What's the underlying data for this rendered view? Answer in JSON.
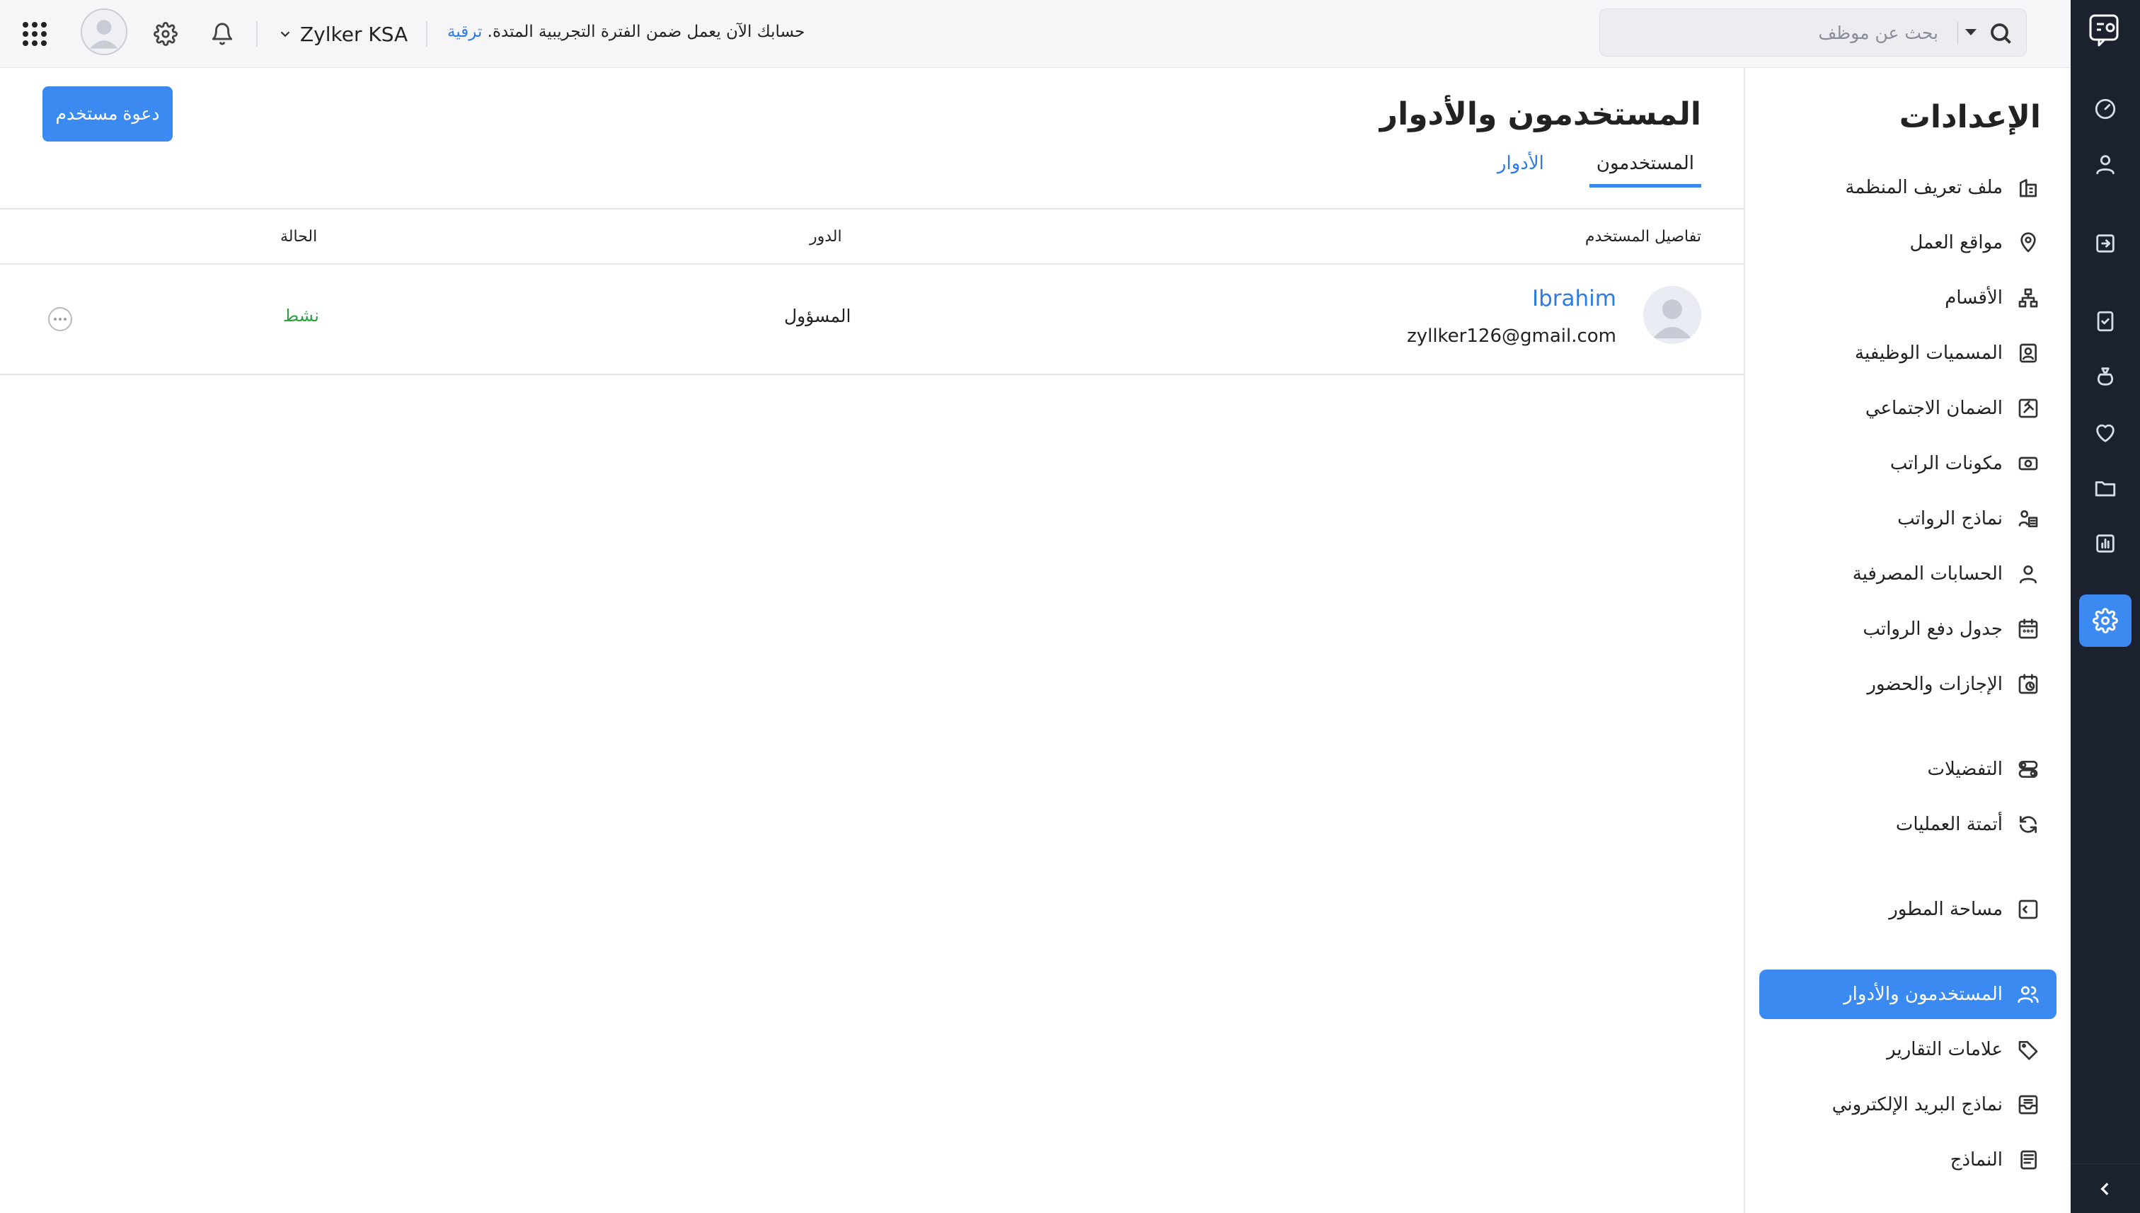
{
  "topbar": {
    "org_name": "Zylker KSA",
    "trial_text": "حسابك الآن يعمل ضمن الفترة التجريبية المتدة.",
    "upgrade_link": "ترقية",
    "search_placeholder": "بحث عن موظف"
  },
  "settings": {
    "title": "الإعدادات",
    "items": [
      {
        "label": "ملف تعريف المنظمة",
        "icon": "building-icon"
      },
      {
        "label": "مواقع العمل",
        "icon": "location-pin-icon"
      },
      {
        "label": "الأقسام",
        "icon": "org-chart-icon"
      },
      {
        "label": "المسميات الوظيفية",
        "icon": "id-badge-icon"
      },
      {
        "label": "الضمان الاجتماعي",
        "icon": "gavel-icon"
      },
      {
        "label": "مكونات الراتب",
        "icon": "money-icon"
      },
      {
        "label": "نماذج الرواتب",
        "icon": "user-template-icon"
      },
      {
        "label": "الحسابات المصرفية",
        "icon": "bank-user-icon"
      },
      {
        "label": "جدول دفع الرواتب",
        "icon": "calendar-icon"
      },
      {
        "label": "الإجازات والحضور",
        "icon": "calendar-clock-icon"
      },
      {
        "label": "التفضيلات",
        "icon": "preferences-icon"
      },
      {
        "label": "أتمتة العمليات",
        "icon": "refresh-icon"
      },
      {
        "label": "مساحة المطور",
        "icon": "code-icon"
      },
      {
        "label": "المستخدمون والأدوار",
        "icon": "users-icon"
      },
      {
        "label": "علامات التقارير",
        "icon": "tag-icon"
      },
      {
        "label": "نماذج البريد الإلكتروني",
        "icon": "mail-template-icon"
      },
      {
        "label": "النماذج",
        "icon": "document-icon"
      }
    ]
  },
  "main": {
    "title": "المستخدمون والأدوار",
    "invite_button": "دعوة مستخدم",
    "tabs": [
      {
        "label": "المستخدمون"
      },
      {
        "label": "الأدوار"
      }
    ],
    "columns": {
      "user_details": "تفاصيل المستخدم",
      "role": "الدور",
      "status": "الحالة"
    },
    "users": [
      {
        "name": "Ibrahim",
        "email": "zyllker126@gmail.com",
        "role": "المسؤول",
        "status": "نشط"
      }
    ]
  },
  "colors": {
    "accent": "#3a8af1",
    "link": "#2d7be6",
    "status_active": "#2ea043",
    "rail_bg": "#1c2130"
  }
}
